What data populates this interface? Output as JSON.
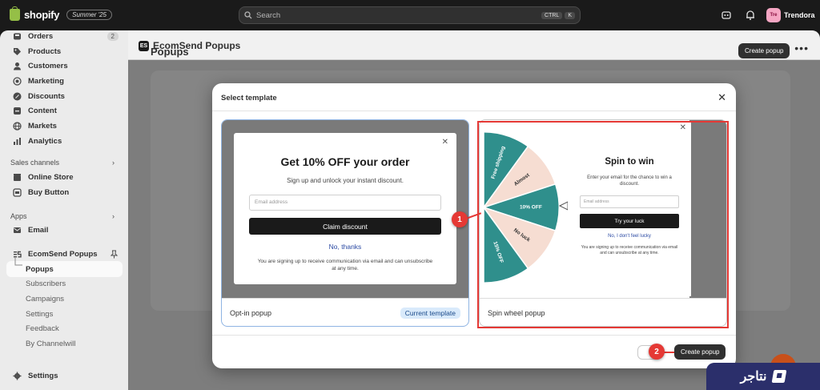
{
  "topbar": {
    "logo": "shopify",
    "edition": "Summer '25",
    "search_placeholder": "Search",
    "shortcut_ctrl": "CTRL",
    "shortcut_k": "K",
    "store_initials": "Tre",
    "store_name": "Trendora"
  },
  "sidebar": {
    "items": [
      {
        "label": "Orders",
        "icon": "inbox-icon",
        "badge": "2"
      },
      {
        "label": "Products",
        "icon": "tag-icon"
      },
      {
        "label": "Customers",
        "icon": "person-icon"
      },
      {
        "label": "Marketing",
        "icon": "target-icon"
      },
      {
        "label": "Discounts",
        "icon": "discount-icon"
      },
      {
        "label": "Content",
        "icon": "content-icon"
      },
      {
        "label": "Markets",
        "icon": "globe-icon"
      },
      {
        "label": "Analytics",
        "icon": "chart-bar-icon"
      }
    ],
    "sales_channels_label": "Sales channels",
    "sales_channels": [
      {
        "label": "Online Store",
        "icon": "store-icon"
      },
      {
        "label": "Buy Button",
        "icon": "buy-button-icon"
      }
    ],
    "apps_label": "Apps",
    "apps": [
      {
        "label": "Email",
        "icon": "email-icon"
      },
      {
        "label": "EcomSend Popups",
        "icon": "ecomsend-icon"
      }
    ],
    "app_sub": [
      "Popups",
      "Subscribers",
      "Campaigns",
      "Settings",
      "Feedback",
      "By Channelwill"
    ],
    "settings_label": "Settings"
  },
  "appbar": {
    "title": "EcomSend Popups",
    "logo_text": "ES"
  },
  "page": {
    "title": "Popups",
    "create_label": "Create popup"
  },
  "modal": {
    "title": "Select template",
    "cards": [
      {
        "name": "Opt-in popup",
        "badge": "Current template",
        "preview": {
          "heading": "Get 10% OFF your order",
          "sub": "Sign up and unlock your instant discount.",
          "input_placeholder": "Email address",
          "button": "Claim discount",
          "decline": "No, thanks",
          "fine": "You are signing up to receive communication via email and can unsubscribe at any time."
        }
      },
      {
        "name": "Spin wheel popup",
        "preview": {
          "heading": "Spin to win",
          "sub": "Enter your email for the chance to win a discount.",
          "input_placeholder": "Email address",
          "button": "Try your luck",
          "decline": "No, I don't feel lucky",
          "fine": "You are signing up to receive communication via email and can unsubscribe at any time.",
          "segments": [
            "Free shipping",
            "Almost",
            "10% OFF",
            "No luck",
            "15% OFF"
          ]
        }
      }
    ],
    "create_label": "Create popup"
  },
  "annotations": {
    "step1": "1",
    "step2": "2"
  },
  "brand": {
    "text": "نتاجر"
  },
  "colors": {
    "accent_red": "#e53935",
    "teal": "#2f8f8c",
    "peach": "#f6ddd2",
    "dark": "#303030"
  }
}
